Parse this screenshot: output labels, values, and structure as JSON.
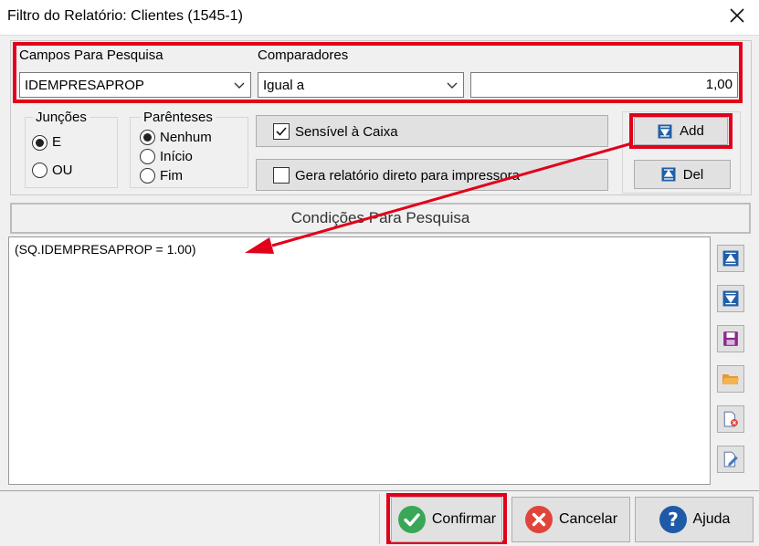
{
  "window": {
    "title": "Filtro do Relatório: Clientes (1545-1)"
  },
  "search": {
    "fields_label": "Campos Para Pesquisa",
    "field_value": "IDEMPRESAPROP",
    "comparators_label": "Comparadores",
    "comparator_value": "Igual a",
    "value_input": "1,00"
  },
  "joins": {
    "legend": "Junções",
    "options": [
      "E",
      "OU"
    ],
    "selected": "E"
  },
  "parentheses": {
    "legend": "Parênteses",
    "options": [
      "Nenhum",
      "Início",
      "Fim"
    ],
    "selected": "Nenhum"
  },
  "options": {
    "case_sensitive": {
      "label": "Sensível à Caixa",
      "checked": true
    },
    "direct_print": {
      "label": "Gera relatório direto para impressora",
      "checked": false
    }
  },
  "actions": {
    "add": "Add",
    "del": "Del"
  },
  "conditions": {
    "header": "Condições Para Pesquisa",
    "text": "(SQ.IDEMPRESAPROP = 1.00)"
  },
  "side_icons": [
    "move-up-icon",
    "move-down-icon",
    "save-icon",
    "open-folder-icon",
    "delete-file-icon",
    "edit-file-icon"
  ],
  "footer": {
    "confirm": "Confirmar",
    "cancel": "Cancelar",
    "help": "Ajuda"
  },
  "colors": {
    "highlight": "#e2001a",
    "accent_blue": "#1f5fa8",
    "confirm_green": "#3aa657",
    "cancel_red": "#e0443a",
    "help_blue": "#1e5aa8"
  }
}
